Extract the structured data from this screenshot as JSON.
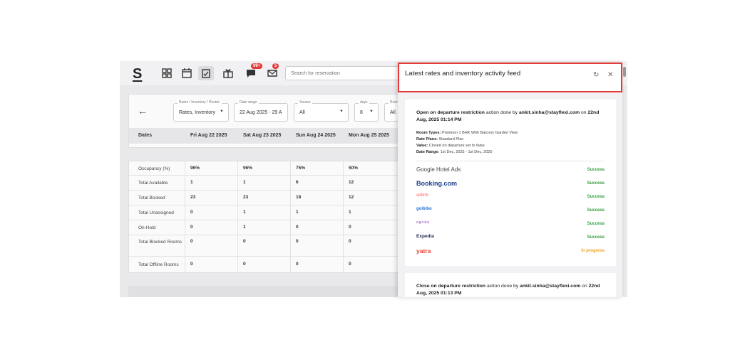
{
  "topbar": {
    "logo": "S",
    "search_placeholder": "Search for reservation",
    "notification_badge": "99+",
    "messages_badge": "5"
  },
  "filters": {
    "rates_label": "Rates / Inventory / Restric",
    "rates_value": "Rates, Inventory",
    "date_label": "Date range",
    "date_value": "22 Aug 2025 - 29 A",
    "source_label": "Source",
    "source_value": "All",
    "days_label": "days",
    "days_value": "8",
    "room_label": "Room",
    "room_value": "All"
  },
  "dates_header": [
    "Dates",
    "Fri Aug 22 2025",
    "Sat Aug 23 2025",
    "Sun Aug 24 2025",
    "Mon Aug 25 2025"
  ],
  "grid_rows": [
    {
      "label": "Occupancy (%)",
      "values": [
        "96%",
        "96%",
        "75%",
        "50%"
      ]
    },
    {
      "label": "Total Available",
      "values": [
        "1",
        "1",
        "6",
        "12"
      ]
    },
    {
      "label": "Total Booked",
      "values": [
        "23",
        "23",
        "18",
        "12"
      ]
    },
    {
      "label": "Total Unassigned",
      "values": [
        "0",
        "1",
        "1",
        "1"
      ]
    },
    {
      "label": "On-Hold",
      "values": [
        "0",
        "1",
        "0",
        "0"
      ]
    },
    {
      "label": "Total Blocked Rooms",
      "values": [
        "0",
        "0",
        "0",
        "0"
      ]
    },
    {
      "label": "Total Offline Rooms",
      "values": [
        "0",
        "0",
        "0",
        "0"
      ]
    }
  ],
  "panel": {
    "title": "Latest rates and inventory activity feed",
    "card1": {
      "action": "Open on departure restriction",
      "mid": " action done by ",
      "user": "ankit.sinha@stayflexi.com",
      "on": " on ",
      "datetime": "22nd Aug, 2025 01:14 PM",
      "room_types_label": "Room Types:",
      "room_types": " Premium 1 BHK With Balcony Garden View",
      "rate_plans_label": "Rate Plans:",
      "rate_plans": " Standard Plan",
      "value_label": "Value:",
      "value": " Closed on departure set to false",
      "date_range_label": "Date Range:",
      "date_range": " 1st Dec, 2025 - 1st Dec, 2025",
      "channels": [
        {
          "name": "Google Hotel Ads",
          "status": "Success"
        },
        {
          "name": "Booking.com",
          "status": "Success"
        },
        {
          "name": "airbnb",
          "status": "Success"
        },
        {
          "name": "goibibo",
          "status": "Success"
        },
        {
          "name": "agoda",
          "status": "Success"
        },
        {
          "name": "Expedia",
          "status": "Success"
        },
        {
          "name": "yatra",
          "status": "In progress"
        }
      ]
    },
    "card2": {
      "action": "Close on departure restriction",
      "mid": " action done by ",
      "user": "ankit.sinha@stayflexi.com",
      "on": " on ",
      "datetime": "22nd Aug, 2025 01:13 PM"
    }
  },
  "colors": {
    "success": "#2e9e3a",
    "in_progress": "#f0a020",
    "highlight_border": "#e53935"
  }
}
